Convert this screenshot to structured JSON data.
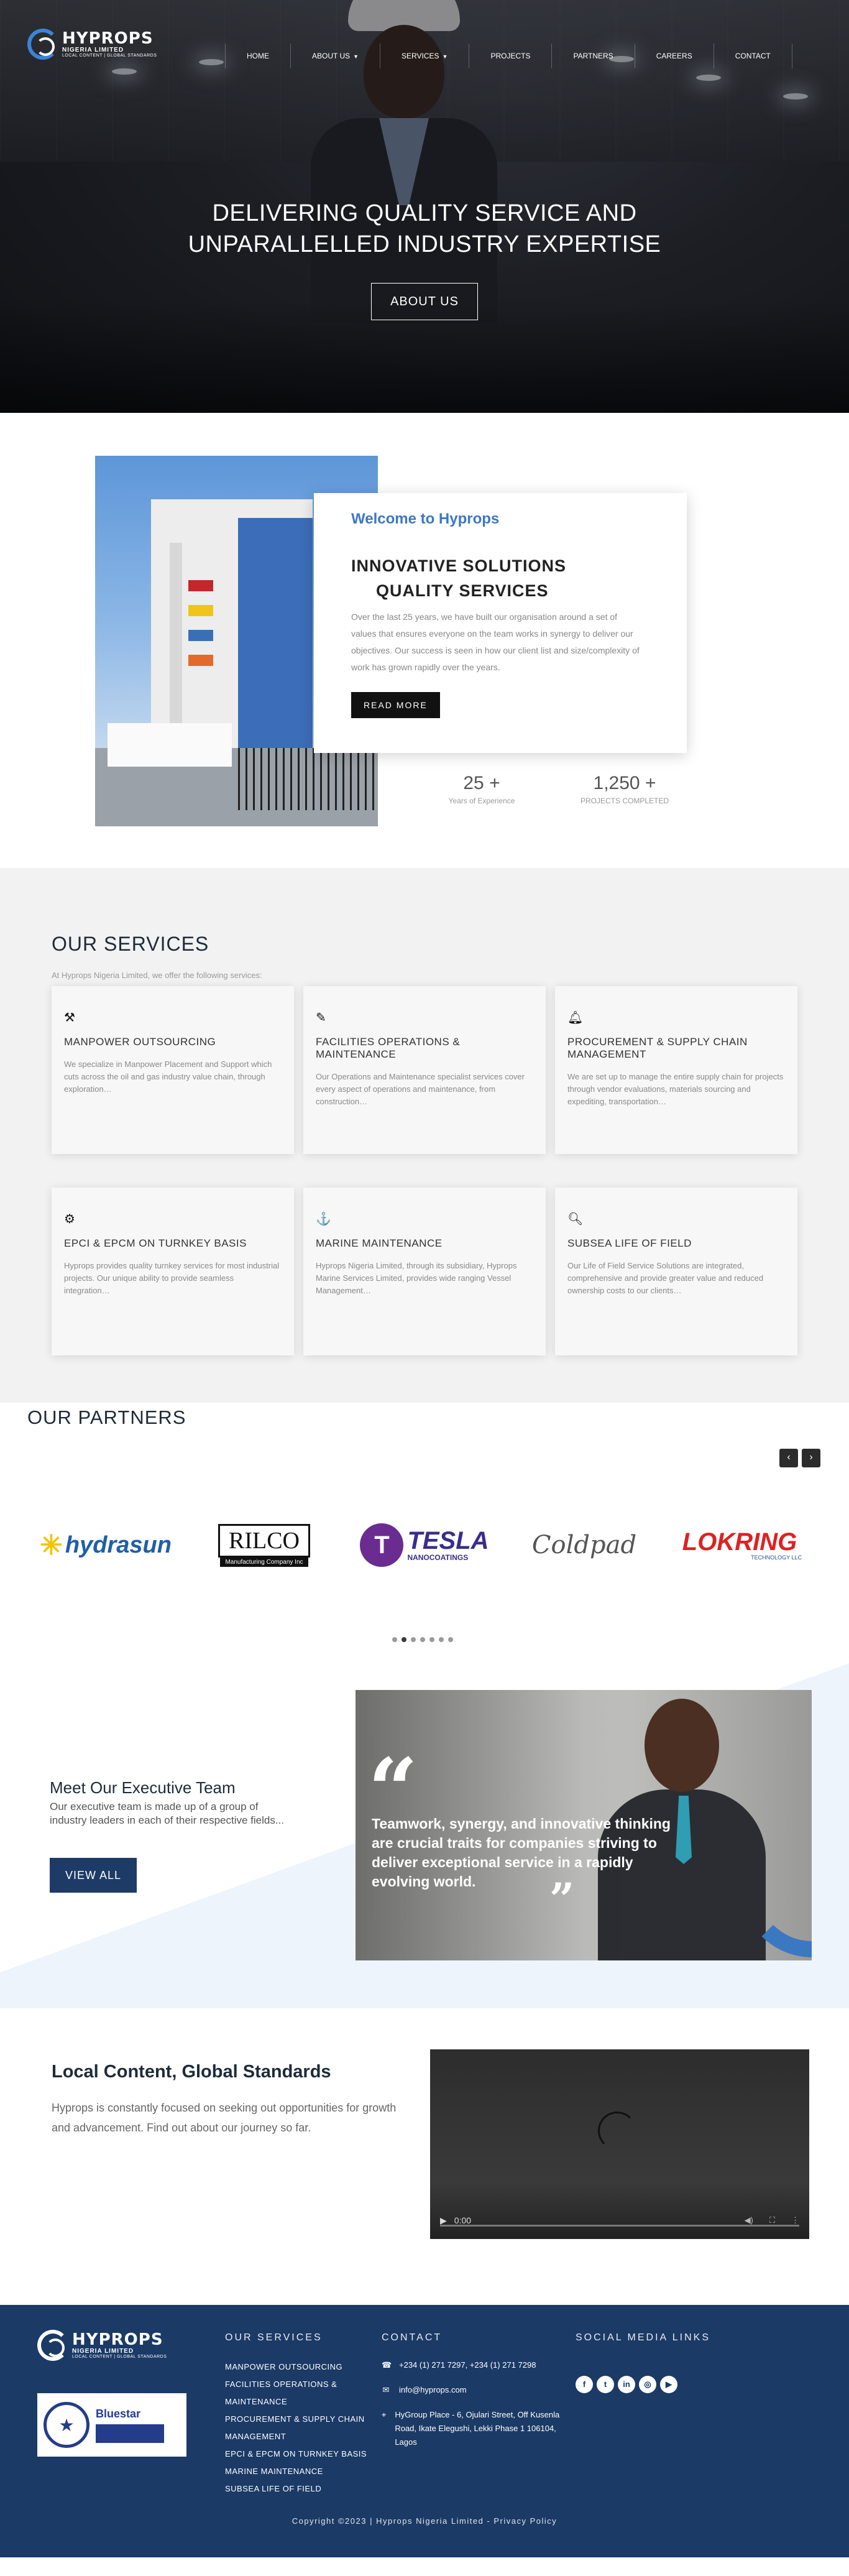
{
  "brand": {
    "name": "HYPROPS",
    "line1": "NIGERIA LIMITED",
    "line2": "LOCAL CONTENT | GLOBAL STANDARDS"
  },
  "nav": {
    "items": [
      {
        "label": "HOME"
      },
      {
        "label": "ABOUT US",
        "dropdown": true
      },
      {
        "label": "SERVICES",
        "dropdown": true
      },
      {
        "label": "PROJECTS"
      },
      {
        "label": "PARTNERS"
      },
      {
        "label": "CAREERS"
      },
      {
        "label": "CONTACT"
      }
    ]
  },
  "hero": {
    "title_line1": "DELIVERING QUALITY SERVICE AND",
    "title_line2": "UNPARALLELLED INDUSTRY EXPERTISE",
    "button": "ABOUT US"
  },
  "about": {
    "kicker": "Welcome to Hyprops",
    "heading_line1": "INNOVATIVE SOLUTIONS",
    "heading_line2": "QUALITY SERVICES",
    "body": "Over the last 25 years, we have built our organisation around a set of values that ensures everyone on the team works in synergy to deliver our objectives. Our success is seen in how our client list and size/complexity of work has grown rapidly over the years.",
    "button": "READ MORE",
    "stats": [
      {
        "value": "25 +",
        "label": "Years of Experience"
      },
      {
        "value": "1,250 +",
        "label": "PROJECTS COMPLETED"
      }
    ]
  },
  "services": {
    "title": "OUR SERVICES",
    "intro": "At Hyprops Nigeria Limited, we offer the following services:",
    "items": [
      {
        "icon": "tools-icon",
        "glyph": "⚒",
        "name": "MANPOWER OUTSOURCING",
        "desc": "We specialize in Manpower Placement and Support which cuts across the oil and gas industry value chain, through exploration…"
      },
      {
        "icon": "pen-icon",
        "glyph": "✎",
        "name": "FACILITIES OPERATIONS & MAINTENANCE",
        "desc": "Our Operations and Maintenance specialist services cover every aspect of operations and maintenance, from construction…"
      },
      {
        "icon": "bell-icon",
        "glyph": "🔔",
        "name": "PROCUREMENT & SUPPLY CHAIN MANAGEMENT",
        "desc": "We are set up to manage the entire supply chain for projects through vendor evaluations, materials sourcing and expediting, transportation…"
      },
      {
        "icon": "gear-icon",
        "glyph": "⚙",
        "name": "EPCI & EPCM ON TURNKEY BASIS",
        "desc": "Hyprops provides quality turnkey services for most industrial projects. Our unique ability to provide seamless integration…"
      },
      {
        "icon": "anchor-icon",
        "glyph": "⚓",
        "name": "MARINE MAINTENANCE",
        "desc": "Hyprops Nigeria Limited, through its subsidiary, Hyprops Marine Services Limited, provides wide ranging Vessel Management…"
      },
      {
        "icon": "search-icon",
        "glyph": "🔍",
        "name": "SUBSEA LIFE OF FIELD",
        "desc": "Our Life of Field Service Solutions are integrated, comprehensive and provide greater value and reduced ownership costs to our clients…"
      }
    ]
  },
  "partners": {
    "title": "OUR PARTNERS",
    "prev": "‹",
    "next": "›",
    "logos": [
      {
        "name": "hydrasun",
        "text": "hydrasun",
        "color": "#1f5fa8"
      },
      {
        "name": "rilco",
        "text": "RILCO",
        "sub": "Manufacturing Company Inc",
        "color": "#111111"
      },
      {
        "name": "tesla-nanocoatings",
        "text": "TESLA",
        "sub": "NANOCOATINGS",
        "color": "#3a2d8f"
      },
      {
        "name": "coldpad",
        "text": "Coldpad",
        "color": "#555555"
      },
      {
        "name": "lookring",
        "text": "LOKRING",
        "sub": "TECHNOLOGY LLC",
        "color": "#d22"
      }
    ],
    "dots_total": 7,
    "dots_active": 1
  },
  "executive": {
    "title": "Meet Our Executive Team",
    "desc": "Our executive team is made up of a group of industry leaders in each of their respective fields...",
    "button": "VIEW ALL",
    "quote": "Teamwork, synergy, and innovative thinking are crucial traits for companies striving to deliver exceptional service in a rapidly evolving world.",
    "open_quote": "“",
    "close_quote": "”"
  },
  "local": {
    "title": "Local Content, Global Standards",
    "desc": "Hyprops is constantly focused on seeking out opportunities for growth and advancement. Find out about our journey so far.",
    "video_time": "0:00"
  },
  "footer": {
    "services_heading": "OUR SERVICES",
    "services": [
      "MANPOWER OUTSOURCING",
      "FACILITIES OPERATIONS & MAINTENANCE",
      "PROCUREMENT & SUPPLY CHAIN MANAGEMENT",
      "EPCI & EPCM ON TURNKEY BASIS",
      "MARINE MAINTENANCE",
      "SUBSEA LIFE OF FIELD"
    ],
    "contact_heading": "CONTACT",
    "phone": "+234 (1) 271 7297, +234 (1) 271 7298",
    "email": "info@hyprops.com",
    "address": "HyGroup Place - 6, Ojulari Street, Off Kusenla Road, Ikate Elegushi, Lekki Phase 1 106104, Lagos",
    "social_heading": "SOCIAL MEDIA LINKS",
    "social": [
      {
        "name": "facebook",
        "glyph": "f"
      },
      {
        "name": "twitter",
        "glyph": "t"
      },
      {
        "name": "linkedin",
        "glyph": "in"
      },
      {
        "name": "instagram",
        "glyph": "◎"
      },
      {
        "name": "youtube",
        "glyph": "▶"
      }
    ],
    "cert_name": "Bluestar",
    "copyright": "Copyright ©2023 | Hyprops Nigeria Limited - Privacy Policy"
  }
}
